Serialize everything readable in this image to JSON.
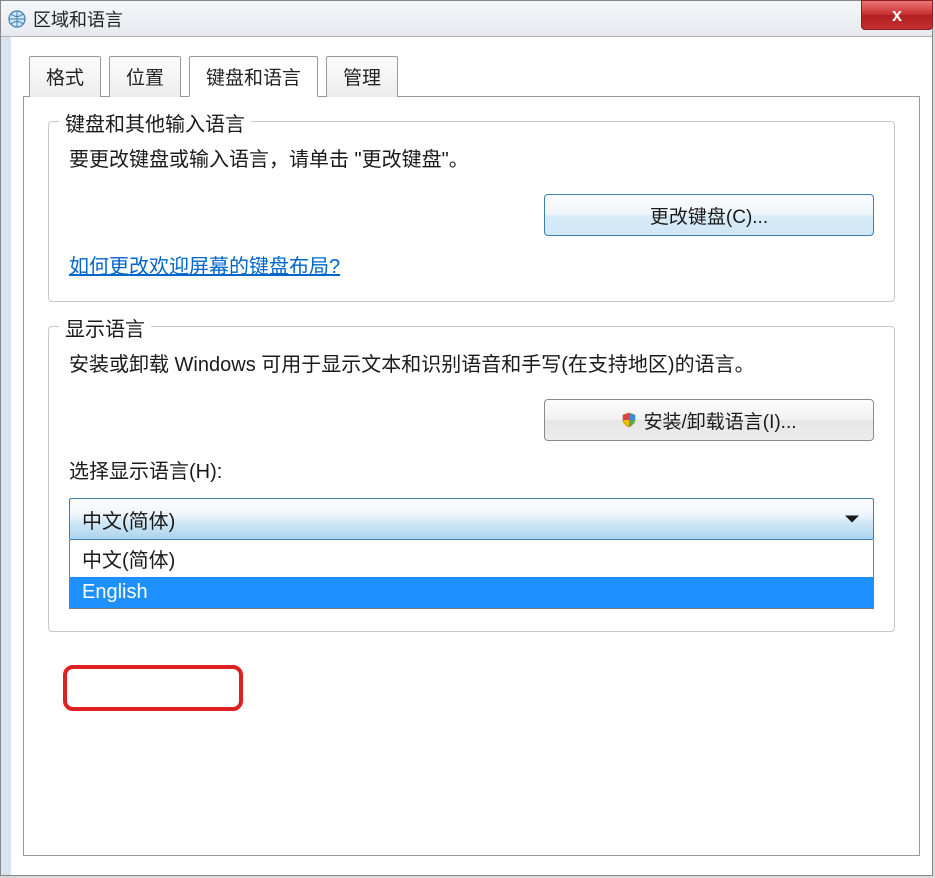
{
  "window": {
    "title": "区域和语言"
  },
  "tabs": [
    {
      "label": "格式"
    },
    {
      "label": "位置"
    },
    {
      "label": "键盘和语言"
    },
    {
      "label": "管理"
    }
  ],
  "group_keyboard": {
    "title": "键盘和其他输入语言",
    "desc": "要更改键盘或输入语言，请单击 \"更改键盘\"。",
    "button": "更改键盘(C)...",
    "link": "如何更改欢迎屏幕的键盘布局?"
  },
  "group_display": {
    "title": "显示语言",
    "desc": "安装或卸载 Windows 可用于显示文本和识别语音和手写(在支持地区)的语言。",
    "button": "安装/卸载语言(I)...",
    "select_label": "选择显示语言(H):",
    "selected": "中文(简体)",
    "options": [
      "中文(简体)",
      "English"
    ]
  }
}
